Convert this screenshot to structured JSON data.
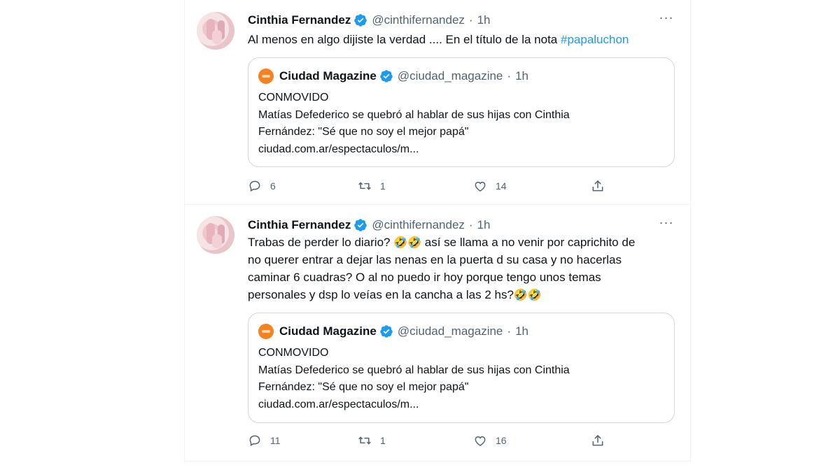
{
  "tweets": [
    {
      "author_name": "Cinthia Fernandez",
      "handle": "@cinthifernandez",
      "separator": "·",
      "time": "1h",
      "more": "···",
      "text_plain": "Al menos en algo dijiste la verdad .... En el título de la nota ",
      "hashtag": "#papaluchon",
      "quote": {
        "name": "Ciudad Magazine",
        "handle": "@ciudad_magazine",
        "separator": "·",
        "time": "1h",
        "line1": "CONMOVIDO",
        "line2": "Matías Defederico se quebró al hablar de sus hijas con Cinthia",
        "line3": "Fernández: \"Sé que no soy el mejor papá\"",
        "line4": "ciudad.com.ar/espectaculos/m..."
      },
      "replies": "6",
      "retweets": "1",
      "likes": "14"
    },
    {
      "author_name": "Cinthia Fernandez",
      "handle": "@cinthifernandez",
      "separator": "·",
      "time": "1h",
      "more": "···",
      "line1a": "Trabas de perder lo diario? ",
      "emoji_laugh2": "🤣🤣",
      "line1b": " así se llama a no venir por caprichito de",
      "line2": "no querer entrar a dejar las nenas en la puerta d su casa y no hacerlas",
      "line3": "caminar 6 cuadras? O al no puedo ir hoy porque tengo unos temas",
      "line4": "personales y dsp lo veías en la cancha a las 2 hs?",
      "quote": {
        "name": "Ciudad Magazine",
        "handle": "@ciudad_magazine",
        "separator": "·",
        "time": "1h",
        "line1": "CONMOVIDO",
        "line2": "Matías Defederico se quebró al hablar de sus hijas con Cinthia",
        "line3": "Fernández: \"Sé que no soy el mejor papá\"",
        "line4": "ciudad.com.ar/espectaculos/m..."
      },
      "replies": "11",
      "retweets": "1",
      "likes": "16"
    }
  ],
  "colors": {
    "verified_blue": "#1d9bf0",
    "hashtag_blue": "#1d9bf0",
    "muted_gray": "#536471",
    "brand_orange": "#f5821f"
  },
  "icons": [
    "reply-icon",
    "retweet-icon",
    "like-icon",
    "share-icon",
    "verified-badge-icon",
    "more-icon"
  ]
}
